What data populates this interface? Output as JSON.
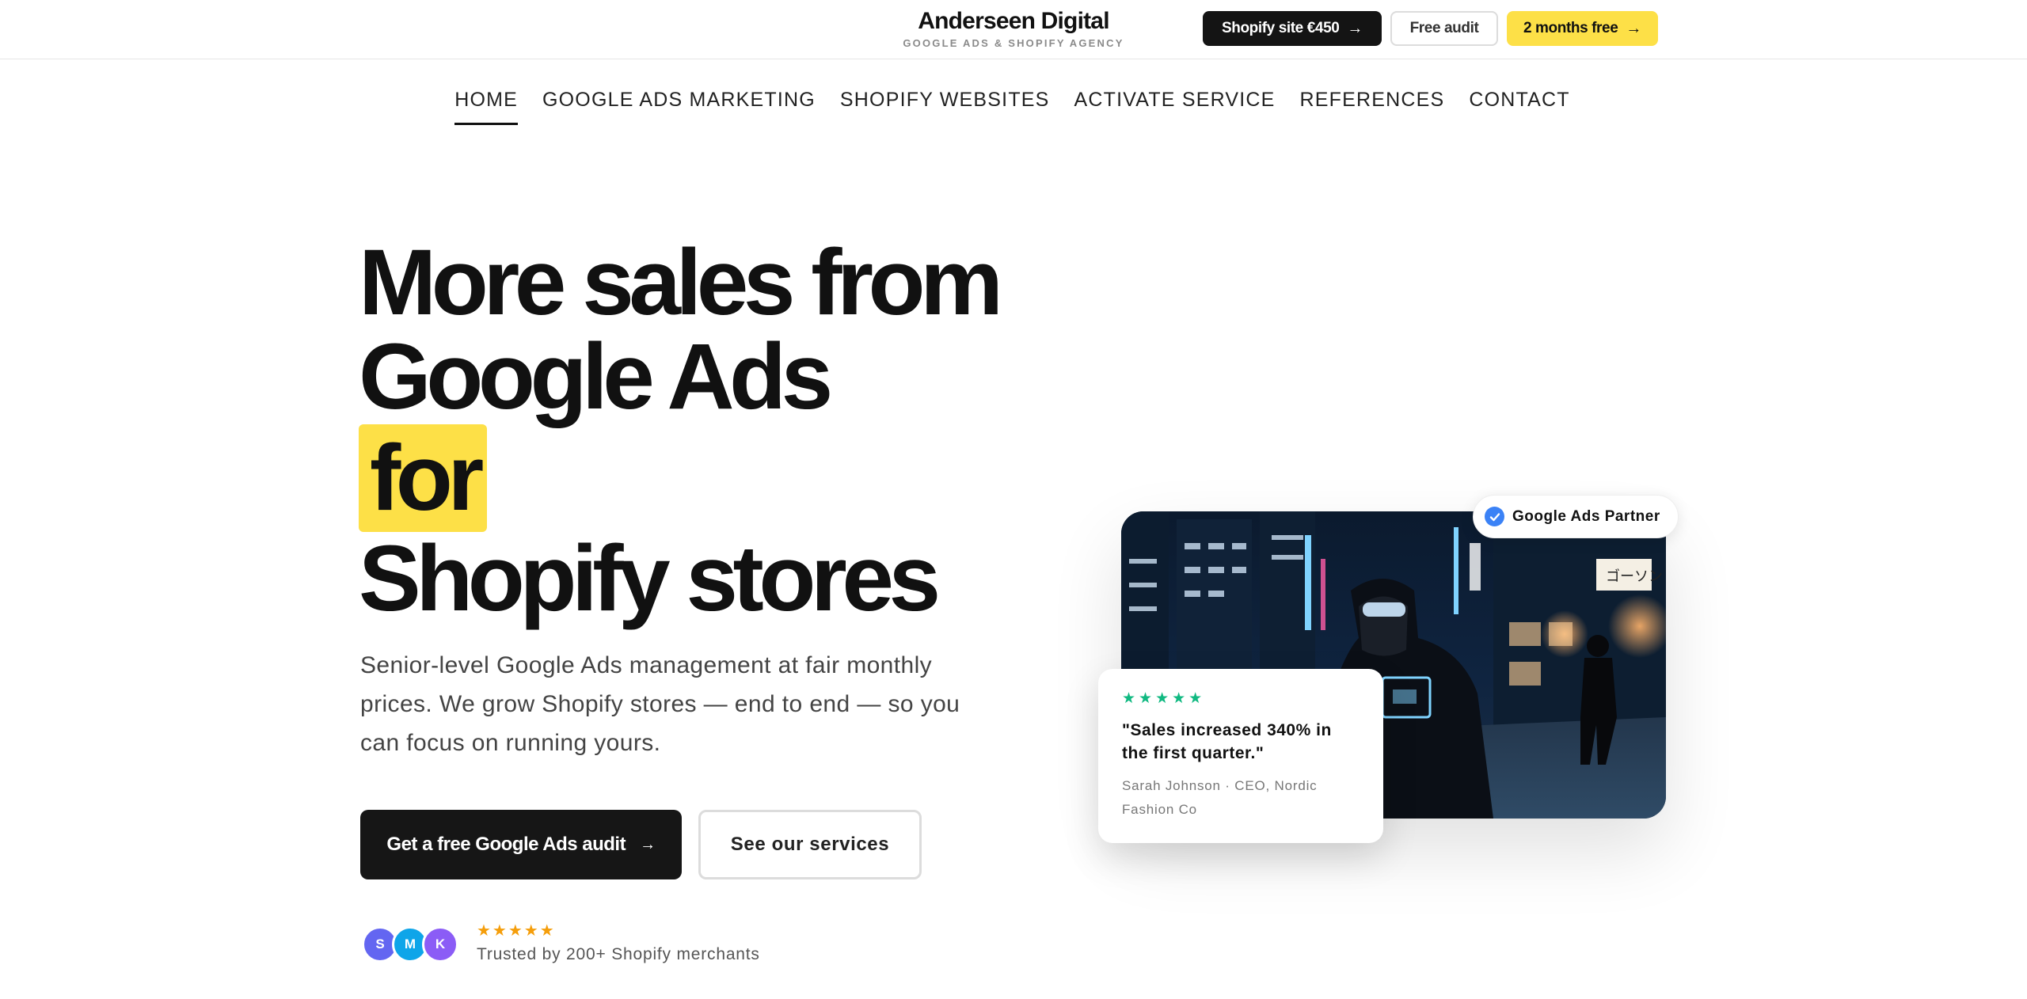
{
  "header": {
    "brand_name": "Anderseen Digital",
    "brand_tagline": "GOOGLE ADS & SHOPIFY AGENCY",
    "actions": {
      "shopify_site": "Shopify site €450",
      "free_audit": "Free audit",
      "months_free": "2 months free"
    }
  },
  "nav": {
    "items": [
      "HOME",
      "GOOGLE ADS MARKETING",
      "SHOPIFY WEBSITES",
      "ACTIVATE SERVICE",
      "REFERENCES",
      "CONTACT"
    ],
    "active": "HOME"
  },
  "hero": {
    "title_line1": "More sales from",
    "title_line2": "Google Ads",
    "title_highlight": "for",
    "title_line4": "Shopify stores",
    "lead": "Senior-level Google Ads management at fair monthly prices. We grow Shopify stores — end to end — so you can focus on running yours.",
    "cta_primary": "Get a free Google Ads audit",
    "cta_secondary": "See our services",
    "trust_avatars": [
      "S",
      "M",
      "K"
    ],
    "trust_rating": 5,
    "trust_text": "Trusted by 200+ Shopify merchants"
  },
  "visual": {
    "partner_badge": "Google Ads Partner",
    "testimonial": {
      "rating": 5,
      "quote": "\"Sales increased 340% in the first quarter.\"",
      "author": "Sarah Johnson · CEO, Nordic Fashion Co"
    }
  },
  "colors": {
    "accent_yellow": "#fde047",
    "dark": "#141414",
    "check_blue": "#3b82f6",
    "star_orange": "#f59e0b",
    "star_green": "#10b981",
    "avatar_colors": [
      "#6366f1",
      "#0ea5e9",
      "#8b5cf6"
    ]
  },
  "icons": {
    "arrow": "arrow-right-icon",
    "check": "check-circle-icon",
    "star": "star-icon"
  }
}
